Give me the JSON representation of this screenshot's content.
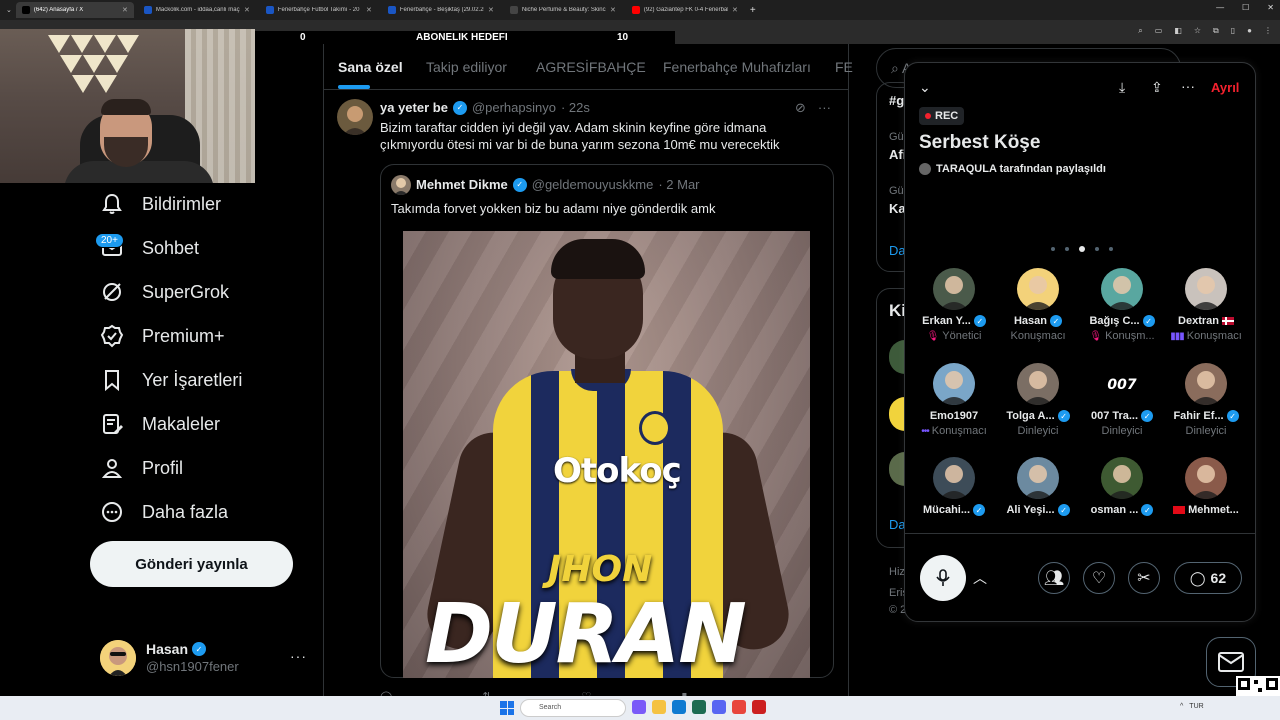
{
  "browser": {
    "tabs": [
      {
        "title": "(642) Anasayfa / X",
        "color": "#000000",
        "active": true
      },
      {
        "title": "Mackolik.com - iddaa,canlı maç",
        "color": "#1a56c4",
        "active": false
      },
      {
        "title": "Fenerbahçe Futbol Takımı - 20",
        "color": "#1a56c4",
        "active": false
      },
      {
        "title": "Fenerbahçe - Beşiktaş (29.02.20",
        "color": "#1a56c4",
        "active": false
      },
      {
        "title": "Niche Perfume & Beauty: Skinc",
        "color": "#444444",
        "active": false
      },
      {
        "title": "(92) Gaziantep FK 0-4 Fenerbah",
        "color": "#ff0000",
        "active": false
      }
    ],
    "new_tab": "+"
  },
  "overlay": {
    "left_value": "0",
    "label": "ABONELIK HEDEFI",
    "right_value": "10"
  },
  "nav": {
    "items": [
      {
        "label": "Bildirimler",
        "icon": "bell-icon"
      },
      {
        "label": "Sohbet",
        "icon": "mail-icon"
      },
      {
        "label": "SuperGrok",
        "icon": "grok-icon"
      },
      {
        "label": "Premium+",
        "icon": "verified-icon"
      },
      {
        "label": "Yer İşaretleri",
        "icon": "bookmark-icon"
      },
      {
        "label": "Makaleler",
        "icon": "article-icon"
      },
      {
        "label": "Profil",
        "icon": "person-icon"
      },
      {
        "label": "Daha fazla",
        "icon": "more-circle-icon"
      }
    ],
    "chat_badge": "20+",
    "post_button": "Gönderi yayınla"
  },
  "account": {
    "name": "Hasan",
    "handle": "@hsn1907fener",
    "more": "···"
  },
  "timeline": {
    "tabs": [
      "Sana özel",
      "Takip ediliyor",
      "AGRESİFBAHÇE",
      "Fenerbahçe Muhafızları",
      "FE"
    ],
    "active_tab": "Sana özel"
  },
  "tweet": {
    "name": "ya yeter be",
    "handle": "@perhapsinyo",
    "time": "· 22s",
    "text": "Bizim taraftar cidden iyi değil yav. Adam skinin keyfine göre idmana çıkmıyordu ötesi mi var bi de buna yarım sezona 10m€ mu verecektik",
    "quote": {
      "name": "Mehmet Dikme",
      "handle": "@geldemouyuskkme",
      "time": "· 2 Mar",
      "text": "Takımda forvet yokken biz bu adamı niye gönderdik amk",
      "image": {
        "sponsor": "Otokoç",
        "first_name": "JHON",
        "last_name": "DURAN"
      }
    }
  },
  "right": {
    "search_placeholder": "A",
    "card1": {
      "tag": "#g",
      "l1": "Gü",
      "l2": "Afi",
      "l3": "Gü",
      "l4": "Ka",
      "link": "Da"
    },
    "card2": {
      "title": "Ki",
      "link": "Da"
    },
    "footer": {
      "f1": "Hizı",
      "f2": "Eriş",
      "f3": "© 2"
    }
  },
  "space": {
    "rec_label": "REC",
    "title": "Serbest Köşe",
    "host_line": "TARAQULA tarafından paylaşıldı",
    "leave_label": "Ayrıl",
    "comment_count": "62",
    "speakers": [
      {
        "name": "Erkan Y...",
        "role": "Yönetici",
        "color": "#4a5a4a",
        "verified": true,
        "role_icon": "muted"
      },
      {
        "name": "Hasan",
        "role": "Konuşmacı",
        "color": "#f3d27a",
        "verified": true,
        "role_icon": ""
      },
      {
        "name": "Bağış C...",
        "role": "Konuşm...",
        "color": "#59a7a0",
        "verified": true,
        "role_icon": "muted"
      },
      {
        "name": "Dextran",
        "role": "Konuşmacı",
        "color": "#c9c2bc",
        "verified": false,
        "role_icon": "wave",
        "flag": "no"
      },
      {
        "name": "Emo1907",
        "role": "Konuşmacı",
        "color": "#7aa6c8",
        "verified": false,
        "role_icon": "dots"
      },
      {
        "name": "Tolga A...",
        "role": "Dinleyici",
        "color": "#7b6e64",
        "verified": true,
        "role_icon": ""
      },
      {
        "name": "007 Tra...",
        "role": "Dinleyici",
        "color": "#000000",
        "verified": true,
        "role_icon": "",
        "logo": "007"
      },
      {
        "name": "Fahir Ef...",
        "role": "Dinleyici",
        "color": "#8a6c5c",
        "verified": true,
        "role_icon": ""
      },
      {
        "name": "Mücahi...",
        "role": "",
        "color": "#3d4c58",
        "verified": true,
        "role_icon": ""
      },
      {
        "name": "Ali Yeşi...",
        "role": "",
        "color": "#6c8aa0",
        "verified": true,
        "role_icon": ""
      },
      {
        "name": "osman ...",
        "role": "",
        "color": "#3e5a32",
        "verified": true,
        "role_icon": ""
      },
      {
        "name": "Mehmet...",
        "role": "",
        "color": "#8a5a4a",
        "verified": false,
        "role_icon": "",
        "flag": "tr"
      }
    ]
  },
  "taskbar": {
    "search_placeholder": "Search",
    "lang": "TUR"
  }
}
